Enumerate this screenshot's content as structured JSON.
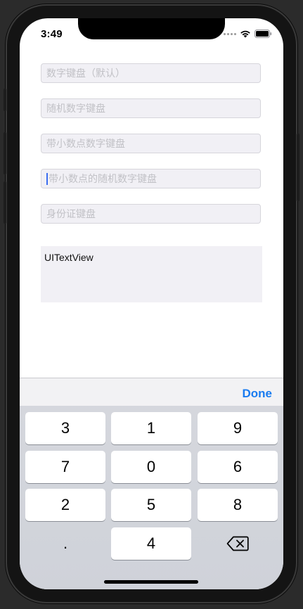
{
  "status_bar": {
    "time": "3:49",
    "icons": [
      "signal-dots-icon",
      "wifi-icon",
      "battery-icon"
    ]
  },
  "fields": [
    {
      "placeholder": "数字键盘（默认）"
    },
    {
      "placeholder": "随机数字键盘"
    },
    {
      "placeholder": "带小数点数字键盘"
    },
    {
      "placeholder": "带小数点的随机数字键盘",
      "focused": true
    },
    {
      "placeholder": "身份证键盘"
    }
  ],
  "text_view": {
    "text": "UITextView"
  },
  "keyboard": {
    "done_label": "Done",
    "rows": [
      [
        "3",
        "1",
        "9"
      ],
      [
        "7",
        "0",
        "6"
      ],
      [
        "2",
        "5",
        "8"
      ],
      [
        ".",
        "4",
        "delete"
      ]
    ],
    "key_color": "#ffffff",
    "background_color": "#d2d5db",
    "accent_color": "#1a7cf0"
  }
}
